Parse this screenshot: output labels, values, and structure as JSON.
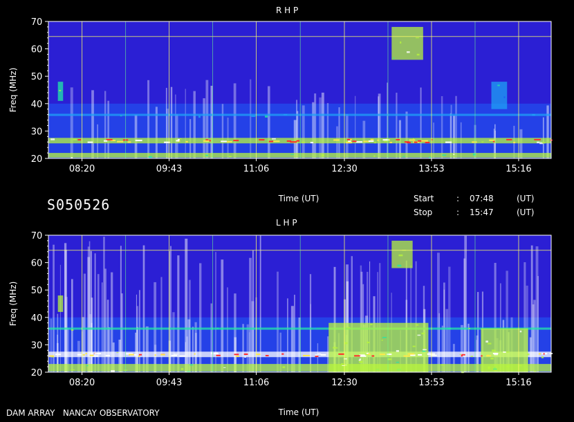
{
  "panels": {
    "top_title": "R H P",
    "bottom_title": "L H P"
  },
  "info": {
    "obs_id": "S050526",
    "start_label": "Start",
    "start_colon": ":",
    "start_value": "07:48",
    "start_unit": "(UT)",
    "stop_label": "Stop",
    "stop_colon": ":",
    "stop_value": "15:47",
    "stop_unit": "(UT)"
  },
  "footer": {
    "station": "DAM ARRAY   NANCAY OBSERVATORY"
  },
  "chart_data": [
    {
      "type": "heatmap",
      "title": "R H P",
      "xlabel": "Time (UT)",
      "ylabel": "Freq (MHz)",
      "x_ticks": [
        "08:20",
        "09:43",
        "11:06",
        "12:30",
        "13:53",
        "15:16"
      ],
      "y_ticks": [
        20,
        30,
        40,
        50,
        60,
        70
      ],
      "xlim": [
        "07:48",
        "15:47"
      ],
      "ylim": [
        20,
        70
      ],
      "grid": true,
      "colormap": [
        "#2b1fd4",
        "#1f5cf5",
        "#1fa2f5",
        "#22e8a8",
        "#b8f53c",
        "#ffffff"
      ],
      "features": [
        {
          "label": "band",
          "freq": [
            25.5,
            27.5
          ],
          "start": "07:48",
          "end": "15:47",
          "level": 0.85
        },
        {
          "label": "band",
          "freq": [
            20.3,
            22
          ],
          "start": "07:48",
          "end": "15:47",
          "level": 0.7
        },
        {
          "label": "band",
          "freq": [
            35.5,
            36.3
          ],
          "start": "07:48",
          "end": "15:47",
          "level": 0.45
        },
        {
          "label": "burst",
          "freq": [
            41,
            48
          ],
          "start": "07:57",
          "end": "08:02",
          "level": 0.6
        },
        {
          "label": "burst",
          "freq": [
            56,
            68
          ],
          "start": "13:15",
          "end": "13:45",
          "level": 0.7
        },
        {
          "label": "burst",
          "freq": [
            38,
            48
          ],
          "start": "14:50",
          "end": "15:05",
          "level": 0.45
        }
      ]
    },
    {
      "type": "heatmap",
      "title": "L H P",
      "xlabel": "Time (UT)",
      "ylabel": "Freq (MHz)",
      "x_ticks": [
        "08:20",
        "09:43",
        "11:06",
        "12:30",
        "13:53",
        "15:16"
      ],
      "y_ticks": [
        20,
        30,
        40,
        50,
        60,
        70
      ],
      "xlim": [
        "07:48",
        "15:47"
      ],
      "ylim": [
        20,
        70
      ],
      "grid": true,
      "colormap": [
        "#2b1fd4",
        "#1f5cf5",
        "#1fa2f5",
        "#22e8a8",
        "#b8f53c",
        "#ffffff"
      ],
      "features": [
        {
          "label": "band",
          "freq": [
            25.5,
            27.5
          ],
          "start": "07:48",
          "end": "15:47",
          "level": 0.95
        },
        {
          "label": "band",
          "freq": [
            20.3,
            23
          ],
          "start": "07:48",
          "end": "15:47",
          "level": 0.75
        },
        {
          "label": "band",
          "freq": [
            35.5,
            36.3
          ],
          "start": "07:48",
          "end": "15:47",
          "level": 0.5
        },
        {
          "label": "burst",
          "freq": [
            42,
            48
          ],
          "start": "07:57",
          "end": "08:02",
          "level": 0.75
        },
        {
          "label": "activity",
          "freq": [
            20,
            38
          ],
          "start": "12:15",
          "end": "13:50",
          "level": 0.8
        },
        {
          "label": "activity",
          "freq": [
            20,
            36
          ],
          "start": "14:40",
          "end": "15:25",
          "level": 0.8
        },
        {
          "label": "burst",
          "freq": [
            58,
            68
          ],
          "start": "13:15",
          "end": "13:35",
          "level": 0.7
        }
      ]
    }
  ]
}
